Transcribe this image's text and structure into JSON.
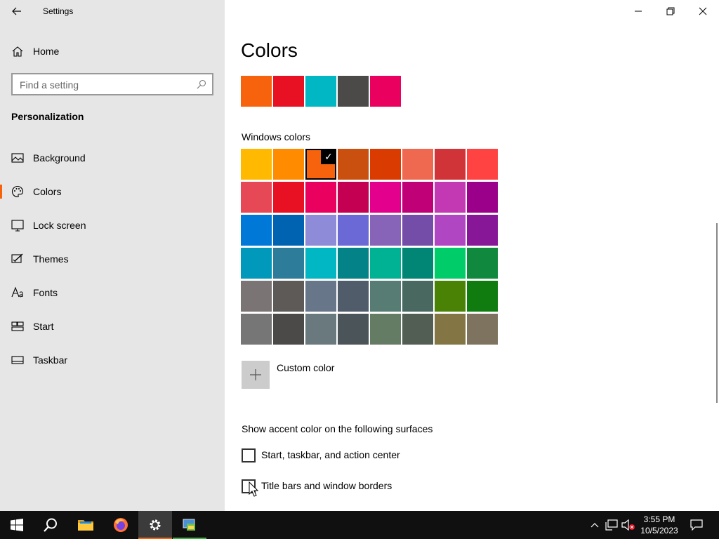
{
  "window": {
    "title": "Settings"
  },
  "sidebar": {
    "home_label": "Home",
    "search_placeholder": "Find a setting",
    "section_title": "Personalization",
    "items": [
      {
        "label": "Background",
        "icon": "image-icon",
        "active": false
      },
      {
        "label": "Colors",
        "icon": "palette-icon",
        "active": true
      },
      {
        "label": "Lock screen",
        "icon": "lock-screen-icon",
        "active": false
      },
      {
        "label": "Themes",
        "icon": "themes-icon",
        "active": false
      },
      {
        "label": "Fonts",
        "icon": "fonts-icon",
        "active": false
      },
      {
        "label": "Start",
        "icon": "start-icon",
        "active": false
      },
      {
        "label": "Taskbar",
        "icon": "taskbar-icon",
        "active": false
      }
    ],
    "accent_color": "#f7630c"
  },
  "main": {
    "title": "Colors",
    "recent_colors": [
      "#f7630c",
      "#e81123",
      "#00b7c3",
      "#4c4a48",
      "#ea005e"
    ],
    "windows_colors_label": "Windows colors",
    "windows_colors": [
      [
        "#ffb900",
        "#ff8c00",
        "#f7630c",
        "#ca5010",
        "#da3b01",
        "#ef6950",
        "#d13438",
        "#ff4343"
      ],
      [
        "#e74856",
        "#e81123",
        "#ea005e",
        "#c30052",
        "#e3008c",
        "#bf0077",
        "#c239b3",
        "#9a0089"
      ],
      [
        "#0078d7",
        "#0063b1",
        "#8e8cd8",
        "#6b69d6",
        "#8764b8",
        "#744da9",
        "#b146c2",
        "#881798"
      ],
      [
        "#0099bc",
        "#2d7d9a",
        "#00b7c3",
        "#038387",
        "#00b294",
        "#018574",
        "#00cc6a",
        "#10893e"
      ],
      [
        "#7a7574",
        "#5d5a58",
        "#68768a",
        "#515c6b",
        "#567c73",
        "#486860",
        "#498205",
        "#107c10"
      ],
      [
        "#767676",
        "#4c4a48",
        "#69797e",
        "#4a5459",
        "#647c64",
        "#525e54",
        "#847545",
        "#7e735f"
      ]
    ],
    "selected_color": {
      "row": 0,
      "col": 2
    },
    "custom_color_label": "Custom color",
    "surfaces_label": "Show accent color on the following surfaces",
    "checkboxes": [
      {
        "label": "Start, taskbar, and action center",
        "checked": false
      },
      {
        "label": "Title bars and window borders",
        "checked": false
      }
    ]
  },
  "taskbar": {
    "apps": [
      {
        "name": "start-button",
        "icon": "windows-logo-icon"
      },
      {
        "name": "search-button",
        "icon": "search-icon"
      },
      {
        "name": "file-explorer-button",
        "icon": "folder-icon"
      },
      {
        "name": "firefox-button",
        "icon": "firefox-icon"
      },
      {
        "name": "settings-taskbar-button",
        "icon": "gear-icon",
        "active": true,
        "underline_color": "#f7630c"
      },
      {
        "name": "control-panel-taskbar-button",
        "icon": "control-panel-icon",
        "underline_color": "#3fb33f"
      }
    ],
    "clock": {
      "time": "3:55 PM",
      "date": "10/5/2023"
    }
  }
}
